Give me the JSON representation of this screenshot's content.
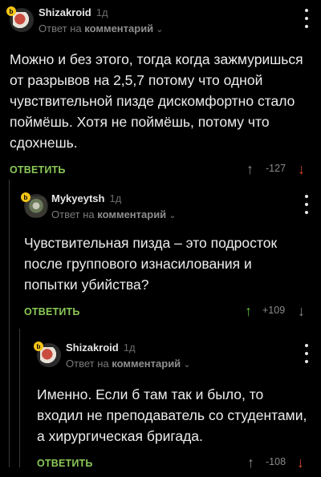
{
  "colors": {
    "background": "#000000",
    "text": "#ededed",
    "muted": "#7a7a7a",
    "reply_green": "#8ac858",
    "upvote_green": "#5ebd3e",
    "downvote_red": "#d9452b",
    "neutral_arrow": "#8a8a8a"
  },
  "comments": [
    {
      "username": "Shizakroid",
      "time": "1д",
      "reply_prefix": "Ответ на",
      "reply_target": "комментарий",
      "text": "Можно и без этого, тогда когда зажмуришься от разрывов на 2,5,7 потому что одной чувствительной пизде дискомфортно стало поймёшь. Хотя не поймёшь, потому что сдохнешь.",
      "reply_label": "ОТВЕТИТЬ",
      "score": "-127",
      "badge": "b",
      "upvote_icon": "arrow-up-icon",
      "downvote_icon": "arrow-down-icon"
    },
    {
      "username": "Mykyeytsh",
      "time": "1д",
      "reply_prefix": "Ответ на",
      "reply_target": "комментарий",
      "text": "Чувствительная пизда – это подросток после группового изнасилования и попытки убийства?",
      "reply_label": "ОТВЕТИТЬ",
      "score": "+109",
      "badge": "b",
      "upvote_icon": "arrow-up-icon",
      "downvote_icon": "arrow-down-icon"
    },
    {
      "username": "Shizakroid",
      "time": "1д",
      "reply_prefix": "Ответ на",
      "reply_target": "комментарий",
      "text": "Именно. Если б там так и было, то входил не преподаватель со студентами, а хирургическая бригада.",
      "reply_label": "ОТВЕТИТЬ",
      "score": "-108",
      "badge": "b",
      "upvote_icon": "arrow-up-icon",
      "downvote_icon": "arrow-down-icon"
    }
  ]
}
